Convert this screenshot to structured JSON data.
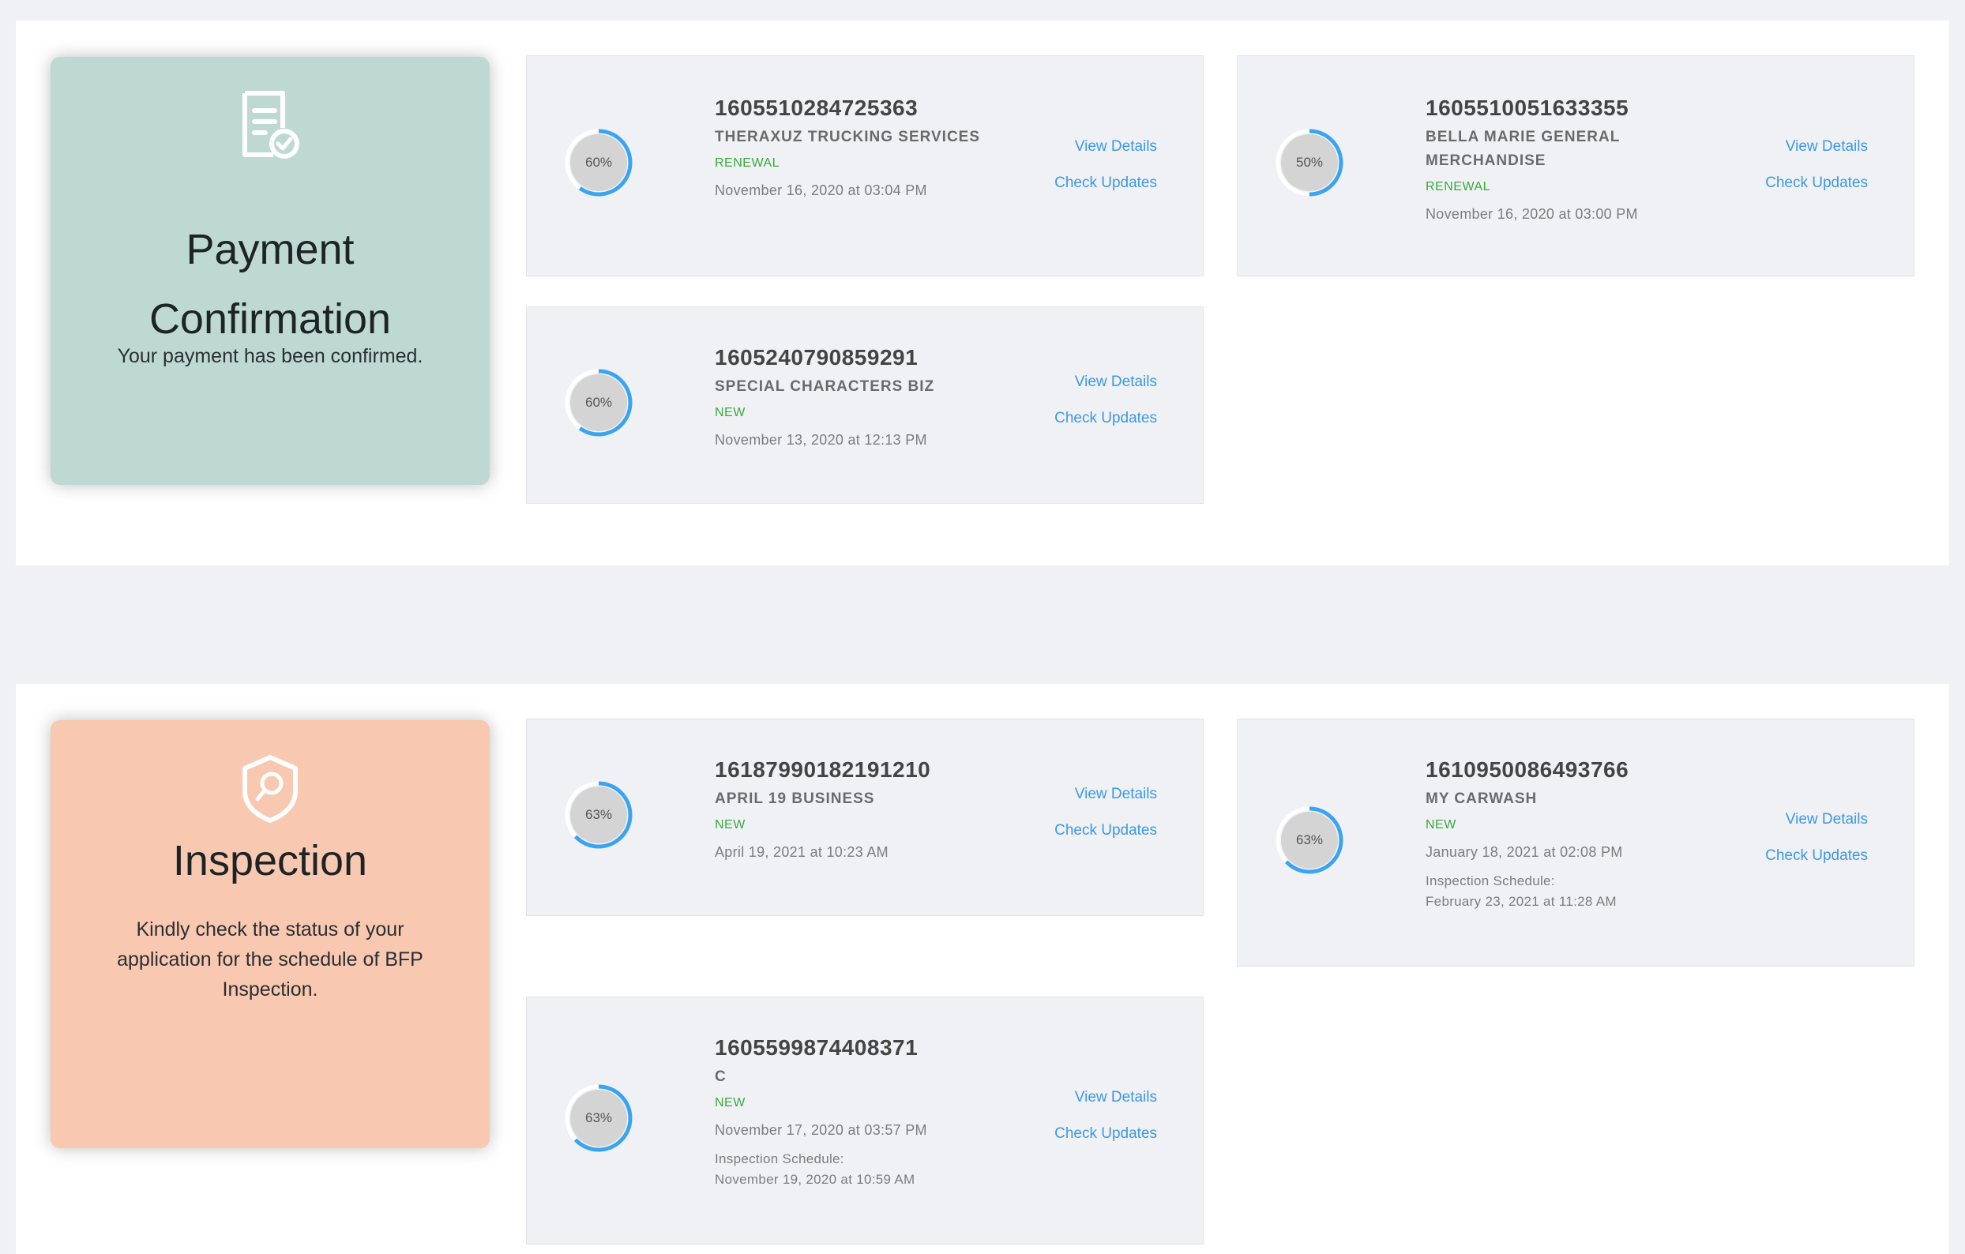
{
  "payment_section": {
    "card": {
      "icon": "document-check-icon",
      "title_line1": "Payment",
      "title_line2": "Confirmation",
      "description": "Your payment has been confirmed.",
      "color": "#bed9d2"
    },
    "applications": [
      {
        "id": "1605510284725363",
        "progress": "60%",
        "progress_value": 60,
        "business_name": "THERAXUZ TRUCKING SERVICES",
        "type": "RENEWAL",
        "date": "November 16, 2020 at 03:04 PM",
        "view_details": "View Details",
        "check_updates": "Check Updates"
      },
      {
        "id": "1605510051633355",
        "progress": "50%",
        "progress_value": 50,
        "business_name": "BELLA MARIE GENERAL MERCHANDISE",
        "type": "RENEWAL",
        "date": "November 16, 2020 at 03:00 PM",
        "view_details": "View Details",
        "check_updates": "Check Updates"
      },
      {
        "id": "1605240790859291",
        "progress": "60%",
        "progress_value": 60,
        "business_name": "SPECIAL CHARACTERS BIZ",
        "type": "NEW",
        "date": "November 13, 2020 at 12:13 PM",
        "view_details": "View Details",
        "check_updates": "Check Updates"
      }
    ]
  },
  "inspection_section": {
    "card": {
      "icon": "shield-search-icon",
      "title": "Inspection",
      "description": "Kindly check the status of your application for the schedule of BFP Inspection.",
      "color": "#f8c8b0"
    },
    "applications": [
      {
        "id": "16187990182191210",
        "progress": "63%",
        "progress_value": 63,
        "business_name": "APRIL 19 BUSINESS",
        "type": "NEW",
        "date": "April 19, 2021 at 10:23 AM",
        "view_details": "View Details",
        "check_updates": "Check Updates"
      },
      {
        "id": "1610950086493766",
        "progress": "63%",
        "progress_value": 63,
        "business_name": "MY CARWASH",
        "type": "NEW",
        "date": "January 18, 2021 at 02:08 PM",
        "schedule_label": "Inspection Schedule:",
        "schedule_date": "February 23, 2021 at 11:28 AM",
        "view_details": "View Details",
        "check_updates": "Check Updates"
      },
      {
        "id": "1605599874408371",
        "progress": "63%",
        "progress_value": 63,
        "business_name": "C",
        "type": "NEW",
        "date": "November 17, 2020 at 03:57 PM",
        "schedule_label": "Inspection Schedule:",
        "schedule_date": "November 19, 2020 at 10:59 AM",
        "view_details": "View Details",
        "check_updates": "Check Updates"
      }
    ]
  },
  "colors": {
    "progress_arc": "#3ba4f0",
    "progress_track": "#ffffff",
    "progress_fill": "#d4d4d4",
    "link": "#3c98e4",
    "type_label": "#3aa83a"
  }
}
